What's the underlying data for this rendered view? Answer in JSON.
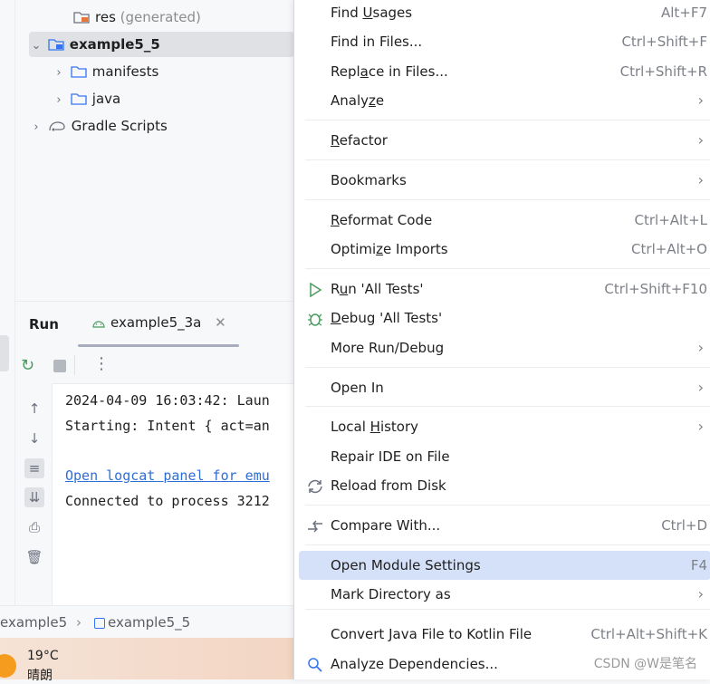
{
  "project_tree": {
    "items": [
      {
        "name": "res",
        "suffix": "(generated)"
      },
      {
        "name": "example5_5"
      },
      {
        "name": "manifests"
      },
      {
        "name": "java"
      },
      {
        "name": "Gradle Scripts"
      }
    ]
  },
  "run_panel": {
    "title": "Run",
    "tab_label": "example5_3a",
    "console": [
      "2024-04-09 16:03:42: Laun",
      "Starting: Intent { act=an",
      "Open logcat panel for emu",
      "Connected to process 3212"
    ]
  },
  "breadcrumb": {
    "items": [
      "example5",
      "example5_5"
    ]
  },
  "taskbar": {
    "temperature": "19°C",
    "weather": "晴朗"
  },
  "context_menu": {
    "items": [
      {
        "pre": "Find ",
        "ul": "U",
        "post": "sages",
        "shortcut": "Alt+F7"
      },
      {
        "pre": "Find in Files...",
        "ul": "",
        "post": "",
        "shortcut": "Ctrl+Shift+F"
      },
      {
        "pre": "Repl",
        "ul": "a",
        "post": "ce in Files...",
        "shortcut": "Ctrl+Shift+R"
      },
      {
        "pre": "Analy",
        "ul": "z",
        "post": "e",
        "shortcut": ""
      },
      {
        "pre": "",
        "ul": "R",
        "post": "efactor",
        "shortcut": ""
      },
      {
        "pre": "Bookmarks",
        "ul": "",
        "post": "",
        "shortcut": ""
      },
      {
        "pre": "",
        "ul": "R",
        "post": "eformat Code",
        "shortcut": "Ctrl+Alt+L"
      },
      {
        "pre": "Optimi",
        "ul": "z",
        "post": "e Imports",
        "shortcut": "Ctrl+Alt+O"
      },
      {
        "pre": "R",
        "ul": "u",
        "post": "n 'All Tests'",
        "shortcut": "Ctrl+Shift+F10"
      },
      {
        "pre": "",
        "ul": "D",
        "post": "ebug 'All Tests'",
        "shortcut": ""
      },
      {
        "pre": "More Run/Debug",
        "ul": "",
        "post": "",
        "shortcut": ""
      },
      {
        "pre": "Open In",
        "ul": "",
        "post": "",
        "shortcut": ""
      },
      {
        "pre": "Local ",
        "ul": "H",
        "post": "istory",
        "shortcut": ""
      },
      {
        "pre": "Repair IDE on File",
        "ul": "",
        "post": "",
        "shortcut": ""
      },
      {
        "pre": "Reload from Disk",
        "ul": "",
        "post": "",
        "shortcut": ""
      },
      {
        "pre": "Compare With...",
        "ul": "",
        "post": "",
        "shortcut": "Ctrl+D"
      },
      {
        "pre": "Open Module Settings",
        "ul": "",
        "post": "",
        "shortcut": "F4"
      },
      {
        "pre": "Mark Directory as",
        "ul": "",
        "post": "",
        "shortcut": ""
      },
      {
        "pre": "Convert Java File to Kotlin File",
        "ul": "",
        "post": "",
        "shortcut": "Ctrl+Alt+Shift+K"
      },
      {
        "pre": "Analyze Dependencies...",
        "ul": "",
        "post": "",
        "shortcut": ""
      }
    ]
  },
  "watermark": "CSDN @W是笔名",
  "colors": {
    "highlight": "#d5e1f8",
    "selected_row": "#dfe1e5",
    "link": "#2f6ed6",
    "run_green": "#4a9c5e"
  }
}
